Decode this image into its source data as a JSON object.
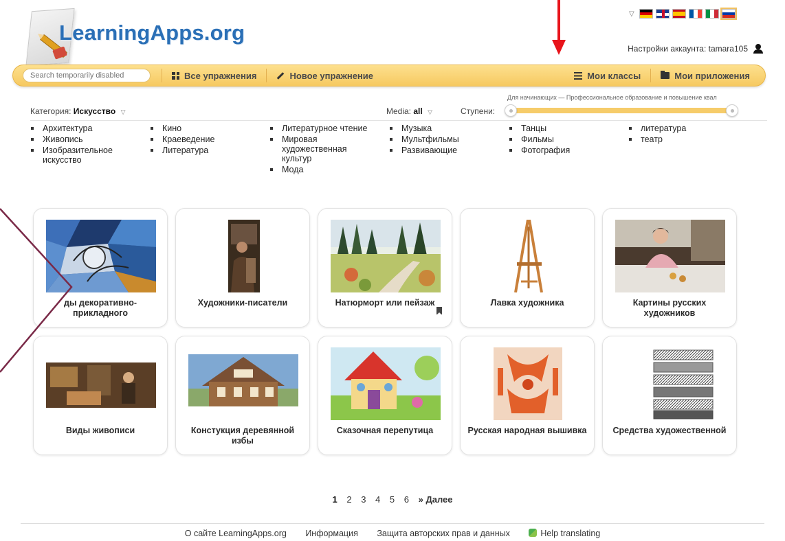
{
  "brand": {
    "logo_text": "LearningApps.org"
  },
  "account": {
    "label": "Настройки аккаунта: tamara105"
  },
  "nav": {
    "search_placeholder": "Search temporarily disabled",
    "all_exercises": "Все упражнения",
    "new_exercise": "Новое упражнение",
    "my_classes": "Мои классы",
    "my_apps": "Мои приложения"
  },
  "filters": {
    "category_label": "Категория:",
    "category_value": "Искусство",
    "media_label": "Media:",
    "media_value": "all",
    "stages_label": "Ступени:",
    "levels_range": "Для начинающих — Профессиональное образование и повышение квал"
  },
  "categories": {
    "col1": [
      "Архитектура",
      "Живопись",
      "Изобразительное искусство"
    ],
    "col2": [
      "Кино",
      "Краеведение",
      "Литература"
    ],
    "col3": [
      "Литературное чтение",
      "Мировая художественная культур",
      "Мода"
    ],
    "col4": [
      "Музыка",
      "Мультфильмы",
      "Развивающие"
    ],
    "col5": [
      "Танцы",
      "Фильмы",
      "Фотография"
    ],
    "col6": [
      "литература",
      "театр"
    ]
  },
  "cards": [
    {
      "title": "Виды декоративно-прикладного",
      "visible_title": "ды декоративно-прикладного"
    },
    {
      "title": "Художники-писатели"
    },
    {
      "title": "Натюрморт или пейзаж"
    },
    {
      "title": "Лавка художника"
    },
    {
      "title": "Картины русских художников"
    },
    {
      "title": "Виды живописи"
    },
    {
      "title": "Констукция деревянной избы"
    },
    {
      "title": "Сказочная перепутица"
    },
    {
      "title": "Русская народная вышивка"
    },
    {
      "title": "Средства художественной"
    }
  ],
  "pagination": {
    "pages": [
      "1",
      "2",
      "3",
      "4",
      "5",
      "6"
    ],
    "next": "» Далее",
    "current": "1"
  },
  "footer": {
    "about": "О сайте LearningApps.org",
    "info": "Информация",
    "privacy": "Защита авторских прав и данных",
    "help": "Help translating"
  },
  "colors": {
    "navbar": "#f6c961",
    "brand_blue": "#2a6fb6",
    "arrow_red": "#e8141b",
    "annotation_line": "#7a2a48"
  }
}
